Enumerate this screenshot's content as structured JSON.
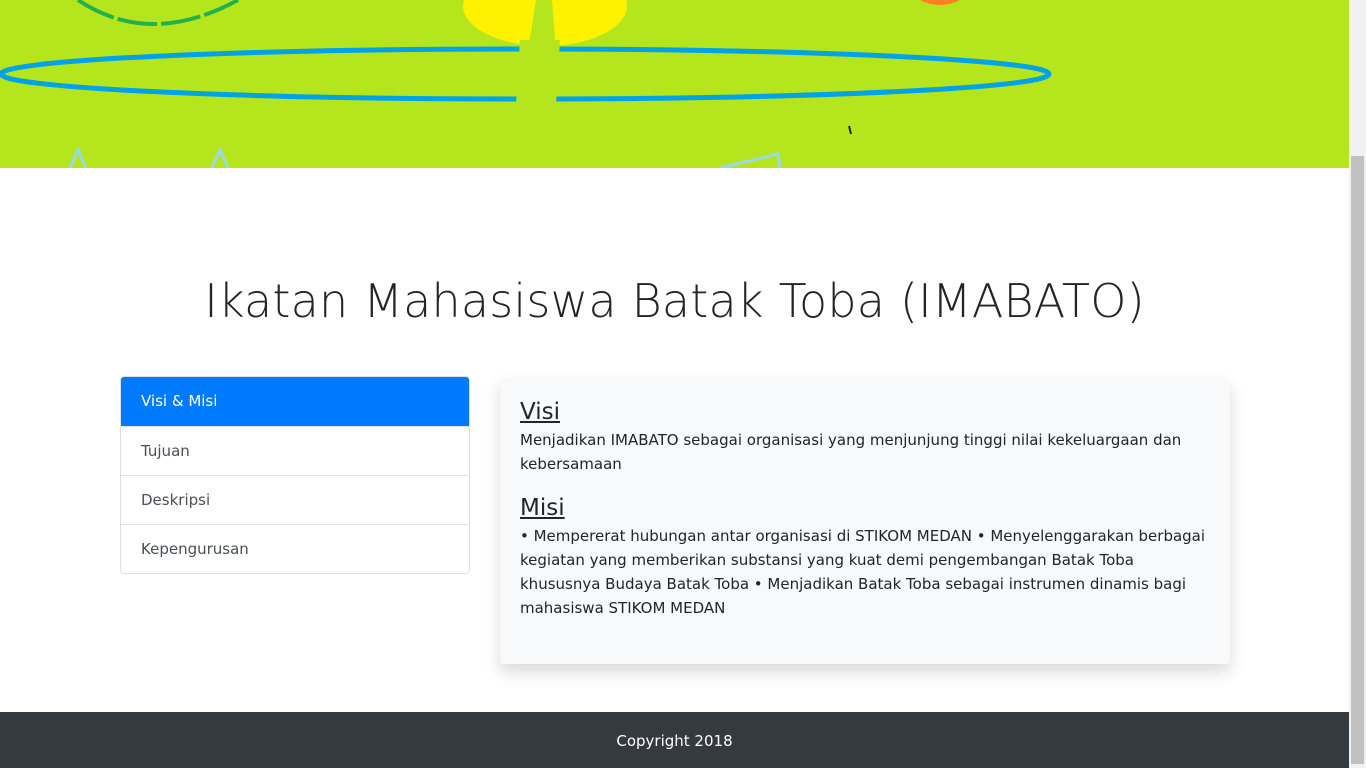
{
  "colors": {
    "hero_background": "#b5e61d",
    "accent": "#007bff",
    "footer_background": "#343a40",
    "card_background": "#f8f9fa"
  },
  "page": {
    "title": "Ikatan Mahasiswa Batak Toba (IMABATO)"
  },
  "sidebar": {
    "items": [
      {
        "label": "Visi & Misi",
        "active": true
      },
      {
        "label": "Tujuan",
        "active": false
      },
      {
        "label": "Deskripsi",
        "active": false
      },
      {
        "label": "Kepengurusan",
        "active": false
      }
    ]
  },
  "content": {
    "visi_heading": "Visi",
    "visi_text": "Menjadikan IMABATO sebagai organisasi yang menjunjung tinggi nilai kekeluargaan dan kebersamaan",
    "misi_heading": "Misi",
    "misi_text": "• Mempererat hubungan antar organisasi di STIKOM MEDAN • Menyelenggarakan berbagai kegiatan yang memberikan substansi yang kuat demi pengembangan Batak Toba khususnya Budaya Batak Toba • Menjadikan Batak Toba sebagai instrumen dinamis bagi mahasiswa STIKOM MEDAN"
  },
  "footer": {
    "copyright": "Copyright 2018"
  }
}
